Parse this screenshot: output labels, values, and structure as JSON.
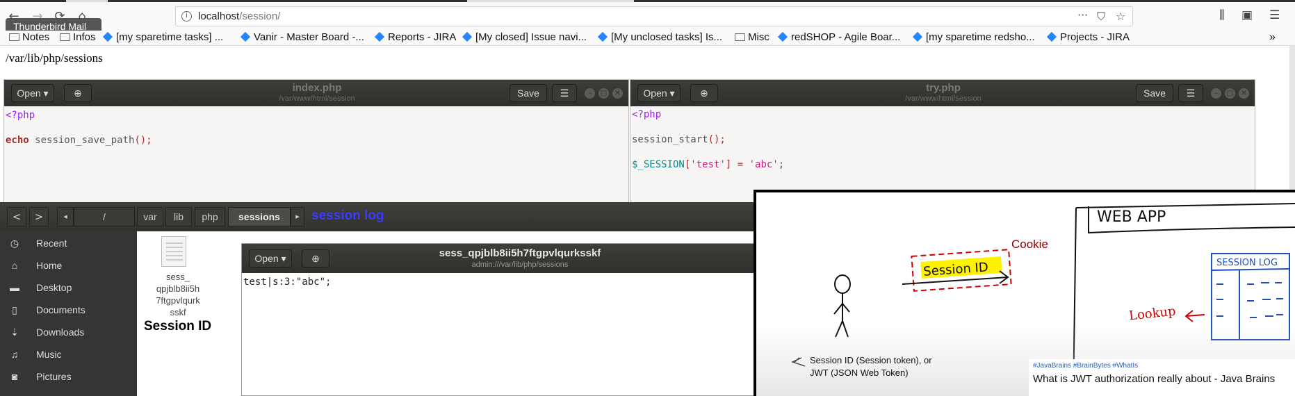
{
  "browser": {
    "url_host": "localhost",
    "url_path": "/session/",
    "tooltip": "Thunderbird Mail",
    "bookmarks": [
      {
        "label": "Notes",
        "kind": "folder"
      },
      {
        "label": "Infos",
        "kind": "folder"
      },
      {
        "label": "[my sparetime tasks] ...",
        "kind": "jira"
      },
      {
        "label": "Vanir - Master Board -...",
        "kind": "jira"
      },
      {
        "label": "Reports - JIRA",
        "kind": "jira"
      },
      {
        "label": "[My closed] Issue navi...",
        "kind": "jira"
      },
      {
        "label": "[My unclosed tasks] Is...",
        "kind": "jira"
      },
      {
        "label": "Misc",
        "kind": "folder"
      },
      {
        "label": "redSHOP - Agile Boar...",
        "kind": "jira"
      },
      {
        "label": "[my sparetime redsho...",
        "kind": "jira"
      },
      {
        "label": "Projects - JIRA",
        "kind": "jira"
      }
    ],
    "overflow": "»"
  },
  "page": {
    "text": "/var/lib/php/sessions"
  },
  "editor_index": {
    "open_label": "Open",
    "save_label": "Save",
    "title": "index.php",
    "subtitle": "/var/www/html/session",
    "lines": [
      "<?php",
      "echo",
      "session_save_path",
      "();"
    ]
  },
  "editor_try": {
    "open_label": "Open",
    "save_label": "Save",
    "title": "try.php",
    "subtitle": "/var/www/html/session",
    "php_tag": "<?php",
    "fn": "session_start",
    "fn_tail": "();",
    "var": "$_SESSION",
    "bracket_open": "[",
    "key": "'test'",
    "bracket_close": "]",
    "assign": " = ",
    "value": "'abc'",
    "semicolon": ";"
  },
  "files": {
    "breadcrumbs": [
      "/",
      "var",
      "lib",
      "php",
      "sessions"
    ],
    "annotation": "session log",
    "sidebar": [
      {
        "label": "Recent",
        "icon": "clock-icon"
      },
      {
        "label": "Home",
        "icon": "home-icon"
      },
      {
        "label": "Desktop",
        "icon": "desktop-icon"
      },
      {
        "label": "Documents",
        "icon": "document-icon"
      },
      {
        "label": "Downloads",
        "icon": "download-icon"
      },
      {
        "label": "Music",
        "icon": "music-icon"
      },
      {
        "label": "Pictures",
        "icon": "camera-icon"
      }
    ],
    "file_lines": [
      "sess_",
      "qpjblb8ii5h",
      "7ftgpvlqurk",
      "sskf"
    ],
    "file_annotation": "Session ID"
  },
  "session_file": {
    "open_label": "Open",
    "title": "sess_qpjblb8ii5h7ftgpvlqurksskf",
    "subtitle": "admin:///var/lib/php/sessions",
    "content": "test|s:3:\"abc\";"
  },
  "video": {
    "web_app": "WEB APP",
    "session_id_label": "Session ID",
    "cookie": "Cookie",
    "session_log": "SESSION LOG",
    "lookup": "Lookup",
    "caption_line1": "Session ID (Session token), or",
    "caption_line2": "JWT (JSON Web Token)",
    "tags": "#JavaBrains #BrainBytes #WhatIs",
    "title": "What is JWT authorization really about - Java Brains"
  }
}
